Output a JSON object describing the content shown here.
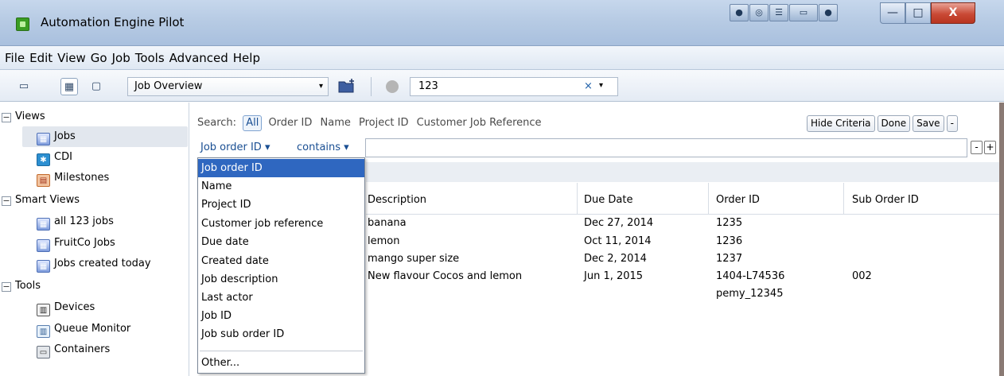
{
  "window": {
    "title": "Automation Engine Pilot",
    "pilot_buttons": [
      "●",
      "◎",
      "☰",
      "▭",
      "●"
    ],
    "minimize": "—",
    "maximize": "□",
    "close": "X"
  },
  "menu": [
    "File",
    "Edit",
    "View",
    "Go",
    "Job",
    "Tools",
    "Advanced",
    "Help"
  ],
  "toolbar": {
    "view_select": "Job Overview",
    "job_field": "123",
    "clear_glyph": "×",
    "dropdown_glyph": "▾"
  },
  "sidebar": {
    "groups": [
      {
        "label": "Views",
        "items": [
          {
            "label": "Jobs",
            "icon": "jobs-icon"
          },
          {
            "label": "CDI",
            "icon": "cdi-icon"
          },
          {
            "label": "Milestones",
            "icon": "milestones-icon"
          }
        ]
      },
      {
        "label": "Smart Views",
        "items": [
          {
            "label": "all 123 jobs",
            "icon": "jobs-icon"
          },
          {
            "label": "FruitCo Jobs",
            "icon": "jobs-icon"
          },
          {
            "label": "Jobs created today",
            "icon": "jobs-icon"
          }
        ]
      },
      {
        "label": "Tools",
        "items": [
          {
            "label": "Devices",
            "icon": "devices-icon"
          },
          {
            "label": "Queue Monitor",
            "icon": "queue-monitor-icon"
          },
          {
            "label": "Containers",
            "icon": "containers-icon"
          }
        ]
      }
    ]
  },
  "search": {
    "label": "Search:",
    "scopes": [
      "All",
      "Order ID",
      "Name",
      "Project ID",
      "Customer Job Reference"
    ],
    "hide_criteria": "Hide Criteria",
    "done": "Done",
    "save": "Save",
    "minus": "-",
    "plus": "+"
  },
  "criteria": {
    "field": "Job order ID ▾",
    "operator": "contains ▾",
    "value": ""
  },
  "dropdown": {
    "items": [
      "Job order ID",
      "Name",
      "Project ID",
      "Customer job reference",
      "Due date",
      "Created date",
      "Job description",
      "Last actor",
      "Job ID",
      "Job sub order ID"
    ],
    "other": "Other...",
    "selected_index": 0
  },
  "table": {
    "columns": [
      "Description",
      "Due Date",
      "Order ID",
      "Sub Order ID"
    ],
    "rows": [
      {
        "description": "banana",
        "due_date": "Dec 27, 2014",
        "order_id": "1235",
        "sub_order_id": ""
      },
      {
        "description": "lemon",
        "due_date": "Oct 11, 2014",
        "order_id": "1236",
        "sub_order_id": ""
      },
      {
        "description": "mango super size",
        "due_date": "Dec 2, 2014",
        "order_id": "1237",
        "sub_order_id": ""
      },
      {
        "description": "New flavour Cocos and lemon",
        "due_date": "Jun 1, 2015",
        "order_id": "1404-L74536",
        "sub_order_id": "002"
      },
      {
        "description": "",
        "due_date": "",
        "order_id": "pemy_12345",
        "sub_order_id": ""
      }
    ]
  }
}
